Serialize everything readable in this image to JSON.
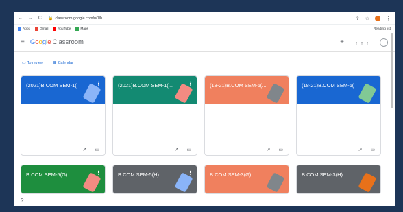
{
  "browser": {
    "nav": "← → C",
    "url": "classroom.google.com/u/1/h",
    "bookmarks": [
      "Apps",
      "Gmail",
      "YouTube",
      "Maps"
    ],
    "reading_list": "Reading list"
  },
  "app": {
    "logo_google": [
      "G",
      "o",
      "o",
      "g",
      "l",
      "e"
    ],
    "logo_product": "Classroom"
  },
  "subnav": {
    "to_review": "To review",
    "calendar": "Calendar"
  },
  "cards": [
    {
      "title": "(2021)B.COM SEM-1(",
      "color": "#1967d2",
      "art": "#8ab4f8"
    },
    {
      "title": "(2021)B.COM SEM-1(...",
      "color": "#138a72",
      "art": "#f28b82"
    },
    {
      "title": "(18-21)B.COM SEM-6(...",
      "color": "#f0805e",
      "art": "#80868b"
    },
    {
      "title": "(18-21)B.COM SEM-6(",
      "color": "#1967d2",
      "art": "#81c995"
    },
    {
      "title": "B.COM SEM-5(G)",
      "color": "#1e8e3e",
      "art": "#f28b82"
    },
    {
      "title": "B.COM SEM-5(H)",
      "color": "#5f6368",
      "art": "#8ab4f8"
    },
    {
      "title": "B.COM SEM-3(G)",
      "color": "#f0805e",
      "art": "#80868b"
    },
    {
      "title": "B.COM SEM-3(H)",
      "color": "#5f6368",
      "art": "#e8711a"
    }
  ],
  "help": "?"
}
